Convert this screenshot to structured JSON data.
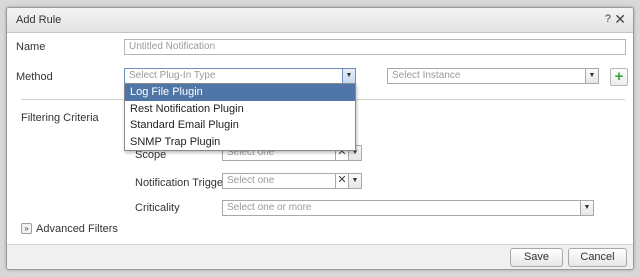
{
  "dialog": {
    "title": "Add Rule",
    "help_icon": "question-mark-icon",
    "close_icon": "close-x-icon"
  },
  "form": {
    "name_label": "Name",
    "name_placeholder": "Untitled Notification",
    "method_label": "Method",
    "plugin_placeholder": "Select Plug-In Type",
    "instance_placeholder": "Select Instance",
    "add_icon": "plus-icon",
    "filtering_label": "Filtering Criteria",
    "scope_label": "Scope",
    "scope_placeholder": "Select one",
    "trigger_label": "Notification Trigger",
    "trigger_placeholder": "Select one",
    "criticality_label": "Criticality",
    "criticality_placeholder": "Select one or more",
    "advanced_label": "Advanced Filters",
    "advanced_icon": "double-chevron-down-icon"
  },
  "plugin_options": [
    "Log File Plugin",
    "Rest Notification Plugin",
    "Standard Email Plugin",
    "SNMP Trap Plugin"
  ],
  "selected_option": "Log File Plugin",
  "footer": {
    "save_label": "Save",
    "cancel_label": "Cancel"
  },
  "colors": {
    "selection": "#4f76a6",
    "add_icon": "#3aa63a"
  }
}
